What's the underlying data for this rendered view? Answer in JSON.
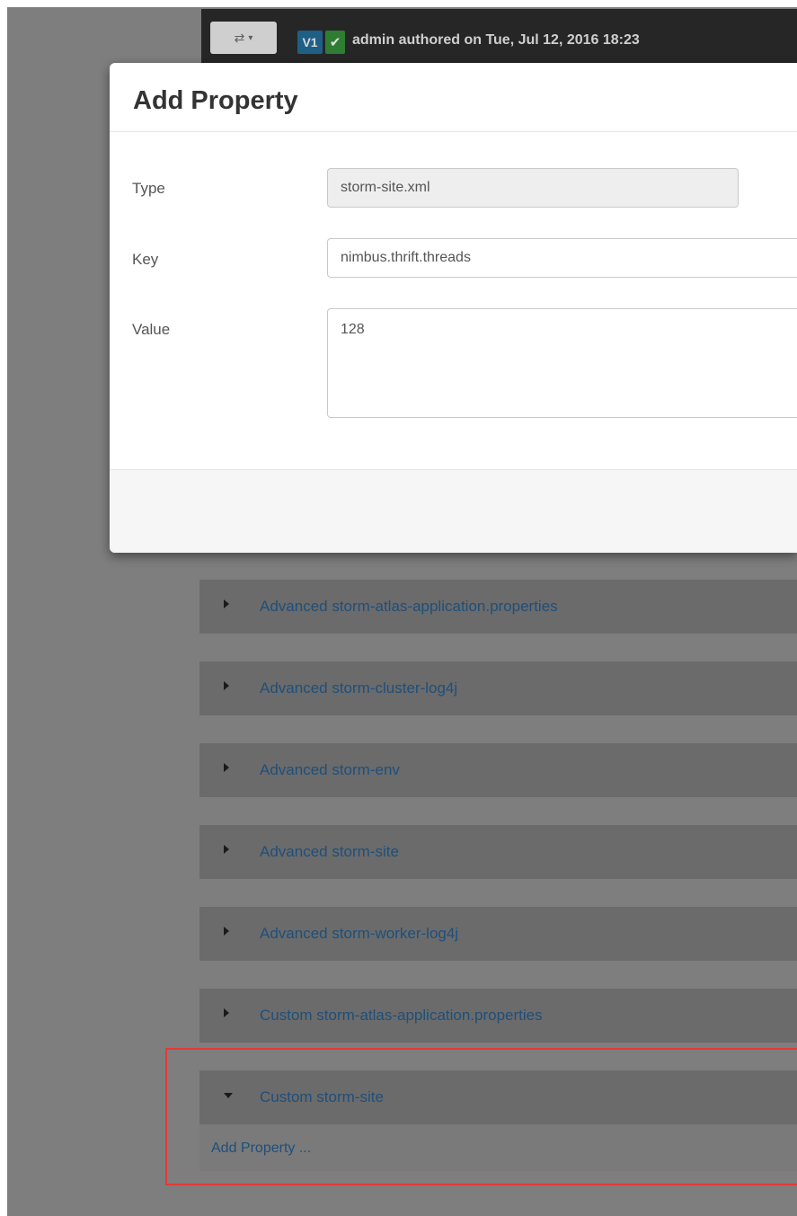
{
  "toolbar": {
    "switch_icon": "shuffle-icon",
    "version_badge": "V1",
    "status_icon": "check-icon",
    "author_text": "admin authored on Tue, Jul 12, 2016 18:23"
  },
  "modal": {
    "title": "Add Property",
    "fields": {
      "type_label": "Type",
      "type_value": "storm-site.xml",
      "key_label": "Key",
      "key_value": "nimbus.thrift.threads",
      "value_label": "Value",
      "value_value": "128"
    }
  },
  "panels": [
    {
      "title": "Advanced storm-atlas-application.properties",
      "expanded": false
    },
    {
      "title": "Advanced storm-cluster-log4j",
      "expanded": false
    },
    {
      "title": "Advanced storm-env",
      "expanded": false
    },
    {
      "title": "Advanced storm-site",
      "expanded": false
    },
    {
      "title": "Advanced storm-worker-log4j",
      "expanded": false
    },
    {
      "title": "Custom storm-atlas-application.properties",
      "expanded": false
    },
    {
      "title": "Custom storm-site",
      "expanded": true,
      "link": "Add Property ..."
    }
  ],
  "colors": {
    "link": "#1f4f7a",
    "highlight": "#e53935",
    "version_badge": "#1e5f86",
    "status_ok": "#2e7d32"
  }
}
